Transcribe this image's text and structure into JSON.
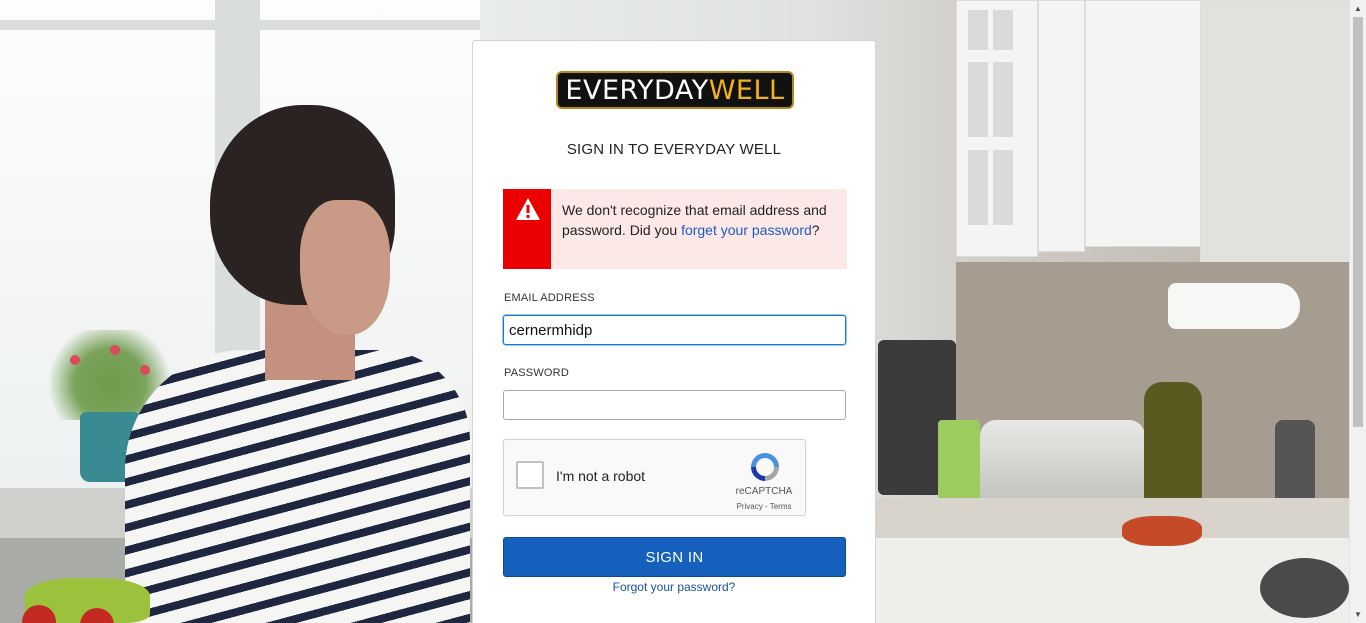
{
  "logo": {
    "word1": "EVERYDAY",
    "word2": "WELL",
    "color_primary": "#ffffff",
    "color_accent": "#f2b316"
  },
  "title": "SIGN IN TO EVERYDAY WELL",
  "alert": {
    "icon": "warning-icon",
    "text_before": "We don't recognize that email address and password. Did you ",
    "link_text": "forget your password",
    "text_after": "?",
    "color": "#ea0000"
  },
  "form": {
    "email_label": "EMAIL ADDRESS",
    "email_value": "cernermhidp",
    "password_label": "PASSWORD",
    "password_value": ""
  },
  "captcha": {
    "label": "I'm not a robot",
    "brand": "reCAPTCHA",
    "links": "Privacy - Terms",
    "checked": false
  },
  "signin_button": "SIGN IN",
  "forgot_link": "Forgot your password?",
  "colors": {
    "button": "#1560bd",
    "link": "#1a5bbd"
  }
}
